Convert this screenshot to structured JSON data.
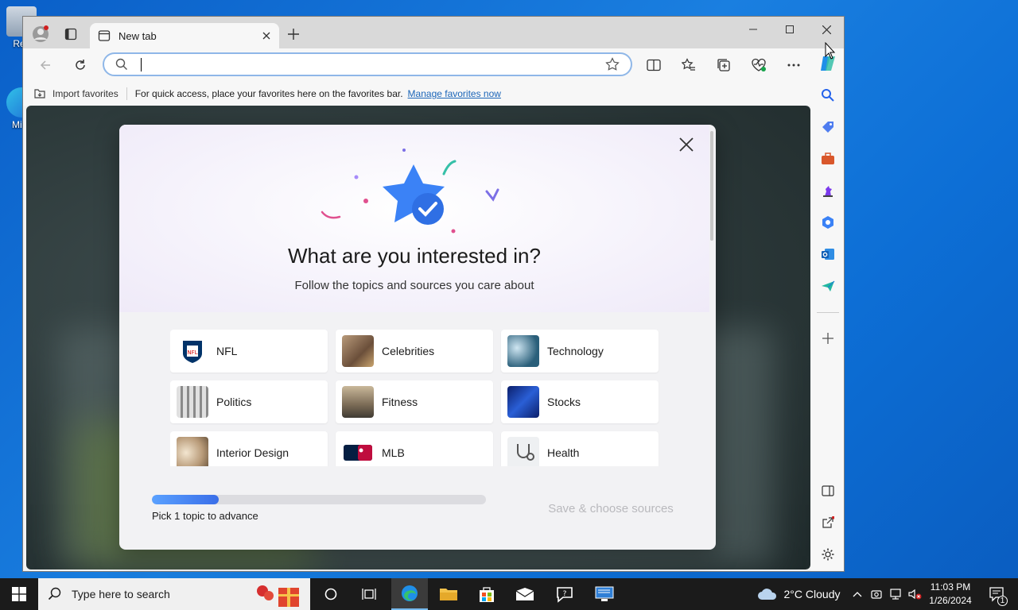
{
  "desktop": {
    "icons": [
      {
        "label": "Rec"
      },
      {
        "label": "Mi E"
      }
    ]
  },
  "browser": {
    "tab": {
      "title": "New tab"
    },
    "window_controls": {
      "minimize": "minimize",
      "maximize": "maximize",
      "close": "close"
    },
    "address_bar": {
      "value": "",
      "placeholder": ""
    },
    "favorites_bar": {
      "import_label": "Import favorites",
      "hint": "For quick access, place your favorites here on the favorites bar.",
      "manage_link": "Manage favorites now"
    }
  },
  "dialog": {
    "title": "What are you interested in?",
    "subtitle": "Follow the topics and sources you care about",
    "topics": [
      {
        "label": "NFL"
      },
      {
        "label": "Celebrities"
      },
      {
        "label": "Technology"
      },
      {
        "label": "Politics"
      },
      {
        "label": "Fitness"
      },
      {
        "label": "Stocks"
      },
      {
        "label": "Interior Design"
      },
      {
        "label": "MLB"
      },
      {
        "label": "Health"
      }
    ],
    "progress": {
      "fraction": 0.2,
      "label": "Pick 1 topic to advance"
    },
    "save_button": "Save & choose sources"
  },
  "taskbar": {
    "search_placeholder": "Type here to search",
    "weather": "2°C  Cloudy",
    "time": "11:03 PM",
    "date": "1/26/2024",
    "notification_count": "1"
  },
  "colors": {
    "accent": "#1a65b8",
    "star": "#3b82f6",
    "progress_fill": "#3a6ee8"
  }
}
